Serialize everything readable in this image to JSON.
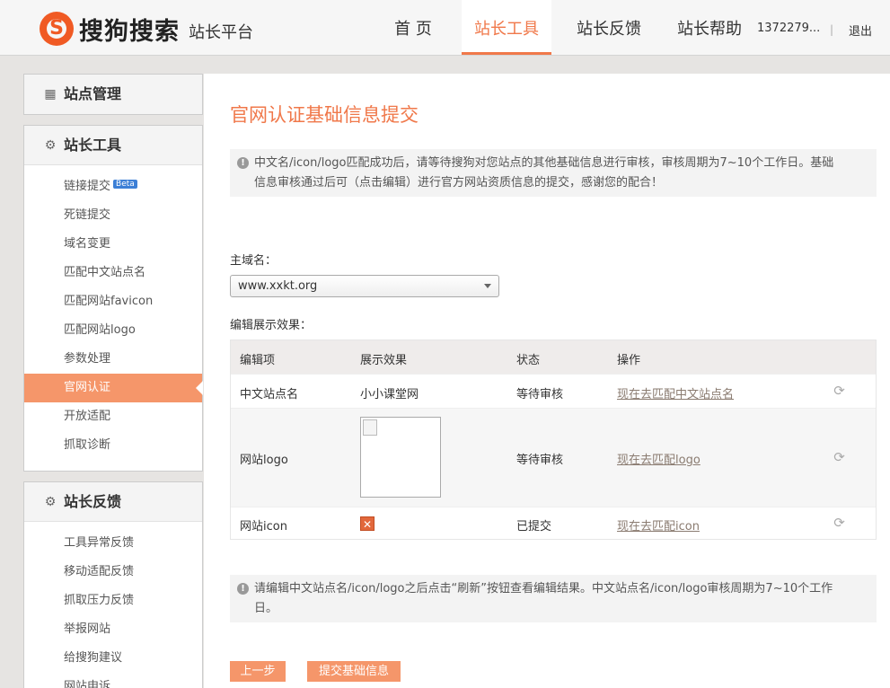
{
  "header": {
    "logo_text": "搜狗搜索",
    "logo_sub": "站长平台",
    "nav": [
      {
        "label": "首 页",
        "active": false
      },
      {
        "label": "站长工具",
        "active": true
      },
      {
        "label": "站长反馈",
        "active": false
      },
      {
        "label": "站长帮助",
        "active": false
      }
    ],
    "user": "1372279...",
    "separator": "|",
    "logout": "退出"
  },
  "sidebar": {
    "site_manage": "站点管理",
    "tools": {
      "title": "站长工具",
      "items": [
        {
          "label": "链接提交",
          "badge": "Beta"
        },
        {
          "label": "死链提交"
        },
        {
          "label": "域名变更"
        },
        {
          "label": "匹配中文站点名"
        },
        {
          "label": "匹配网站favicon"
        },
        {
          "label": "匹配网站logo"
        },
        {
          "label": "参数处理"
        },
        {
          "label": "官网认证",
          "active": true
        },
        {
          "label": "开放适配"
        },
        {
          "label": "抓取诊断"
        }
      ]
    },
    "feedback": {
      "title": "站长反馈",
      "items": [
        {
          "label": "工具异常反馈"
        },
        {
          "label": "移动适配反馈"
        },
        {
          "label": "抓取压力反馈"
        },
        {
          "label": "举报网站"
        },
        {
          "label": "给搜狗建议"
        },
        {
          "label": "网站申诉"
        }
      ]
    }
  },
  "main": {
    "title": "官网认证基础信息提交",
    "notice1_line1": "中文名/icon/logo匹配成功后，请等待搜狗对您站点的其他基础信息进行审核，审核周期为7~10个工作日。基础",
    "notice1_line2": "信息审核通过后可（点击编辑）进行官方网站资质信息的提交，感谢您的配合！",
    "domain_label": "主域名：",
    "domain_value": "www.xxkt.org",
    "preview_label": "编辑展示效果：",
    "table": {
      "headers": [
        "编辑项",
        "展示效果",
        "状态",
        "操作"
      ],
      "rows": [
        {
          "item": "中文站点名",
          "display": "小小课堂网",
          "status": "等待审核",
          "action": "现在去匹配中文站点名"
        },
        {
          "item": "网站logo",
          "display": "",
          "status": "等待审核",
          "action": "现在去匹配logo"
        },
        {
          "item": "网站icon",
          "display": "",
          "status": "已提交",
          "action": "现在去匹配icon"
        }
      ]
    },
    "notice2_line1": "请编辑中文站点名/icon/logo之后点击“刷新”按钮查看编辑结果。中文站点名/icon/logo审核周期为7~10个工作",
    "notice2_line2": "日。",
    "prev_button": "上一步",
    "submit_button": "提交基础信息"
  },
  "colors": {
    "accent": "#f0784a",
    "sidebar_active": "#f5966a"
  },
  "icons": {
    "sidebar_manage": "grid-icon",
    "sidebar_tools": "gear-icon",
    "refresh": "refresh-icon",
    "info": "info-icon"
  }
}
